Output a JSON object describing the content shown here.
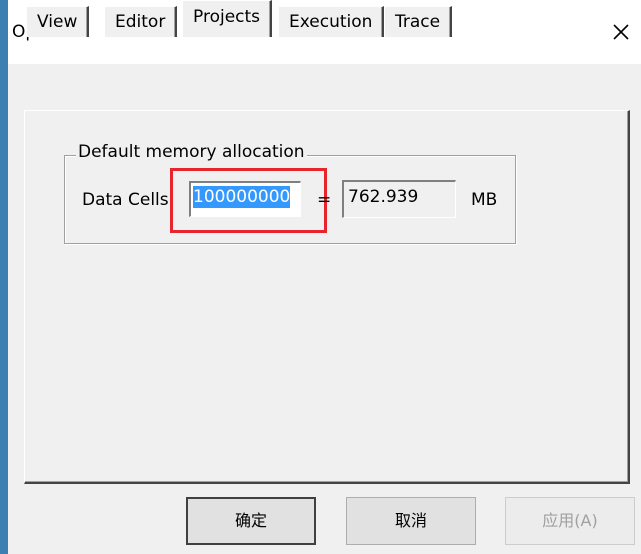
{
  "window": {
    "title": "Options"
  },
  "tabs": [
    {
      "label": "View",
      "active": false
    },
    {
      "label": "Editor",
      "active": false
    },
    {
      "label": "Projects",
      "active": true
    },
    {
      "label": "Execution",
      "active": false
    },
    {
      "label": "Trace",
      "active": false
    }
  ],
  "memory_group": {
    "legend": "Default memory allocation",
    "data_cells_label": "Data Cells:",
    "data_cells_value": "100000000",
    "equals": "=",
    "mb_value": "762.939",
    "unit": "MB"
  },
  "buttons": {
    "ok": "确定",
    "cancel": "取消",
    "apply": "应用(A)"
  },
  "colors": {
    "highlight_box": "#e8242d",
    "selection": "#3399ff",
    "accent_left": "#3c7fb1"
  },
  "icons": {
    "close": "close-icon"
  }
}
